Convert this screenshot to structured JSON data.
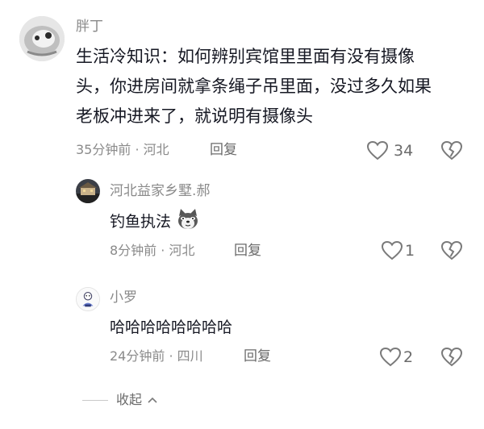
{
  "comments": [
    {
      "username": "胖丁",
      "text": "生活冷知识：如何辨别宾馆里里面有没有摄像头，你进房间就拿条绳子吊里面，没过多久如果老板冲进来了，就说明有摄像头",
      "lines": [
        "生活冷知识：如何辨别宾馆里里面有没有摄像",
        "头，你进房间就拿条绳子吊里面，没过多久如果",
        "老板冲进来了，就说明有摄像头"
      ],
      "meta": "35分钟前 · 河北",
      "reply_label": "回复",
      "likes": "34",
      "replies": [
        {
          "username": "河北益家乡墅.郝",
          "text": "钓鱼执法",
          "emoji": "dog-emoji",
          "meta": "8分钟前 · 河北",
          "reply_label": "回复",
          "likes": "1"
        },
        {
          "username": "小罗",
          "text": "哈哈哈哈哈哈哈哈",
          "meta": "24分钟前 · 四川",
          "reply_label": "回复",
          "likes": "2"
        }
      ]
    }
  ],
  "collapse_label": "收起",
  "icons": {
    "like": "heart-outline-icon",
    "dislike": "broken-heart-outline-icon",
    "collapse": "chevron-up-icon"
  }
}
